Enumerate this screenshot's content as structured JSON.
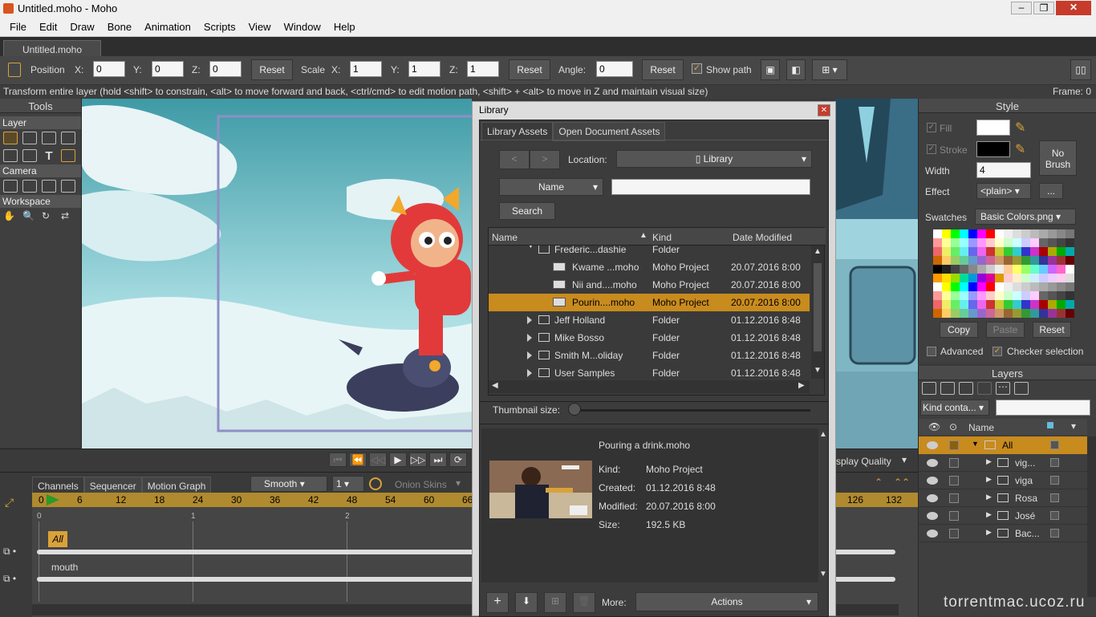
{
  "window": {
    "title": "Untitled.moho - Moho"
  },
  "menu": [
    "File",
    "Edit",
    "Draw",
    "Bone",
    "Animation",
    "Scripts",
    "View",
    "Window",
    "Help"
  ],
  "doc_tab": "Untitled.moho",
  "toolopts": {
    "position": "Position",
    "x_label": "X:",
    "x_val": "0",
    "y_label": "Y:",
    "y_val": "0",
    "z_label": "Z:",
    "z_val": "0",
    "reset": "Reset",
    "scale": "Scale",
    "sx_label": "X:",
    "sx_val": "1",
    "sy_label": "Y:",
    "sy_val": "1",
    "sz_label": "Z:",
    "sz_val": "1",
    "angle": "Angle:",
    "angle_val": "0",
    "show_path": "Show path"
  },
  "hint": "Transform entire layer (hold <shift> to constrain, <alt> to move forward and back, <ctrl/cmd> to edit motion path, <shift> + <alt> to move in Z and maintain visual size)",
  "frame": "Frame: 0",
  "tools": {
    "title": "Tools",
    "layer": "Layer",
    "camera": "Camera",
    "workspace": "Workspace"
  },
  "library": {
    "title": "Library",
    "tabs": [
      "Library Assets",
      "Open Document Assets"
    ],
    "location_label": "Location:",
    "location_value": "Library",
    "sort": "Name",
    "search": "Search",
    "cols": [
      "Name",
      "Kind",
      "Date Modified"
    ],
    "rows": [
      {
        "name": "Frederic...dashie",
        "kind": "Folder",
        "date": "",
        "indent": 1,
        "type": "folder-open"
      },
      {
        "name": "Kwame ...moho",
        "kind": "Moho Project",
        "date": "20.07.2016 8:00",
        "indent": 2,
        "type": "file"
      },
      {
        "name": "Nii and....moho",
        "kind": "Moho Project",
        "date": "20.07.2016 8:00",
        "indent": 2,
        "type": "file"
      },
      {
        "name": "Pourin....moho",
        "kind": "Moho Project",
        "date": "20.07.2016 8:00",
        "indent": 2,
        "type": "file",
        "selected": true
      },
      {
        "name": "Jeff Holland",
        "kind": "Folder",
        "date": "01.12.2016 8:48",
        "indent": 1,
        "type": "folder"
      },
      {
        "name": "Mike Bosso",
        "kind": "Folder",
        "date": "01.12.2016 8:48",
        "indent": 1,
        "type": "folder"
      },
      {
        "name": "Smith M...oliday",
        "kind": "Folder",
        "date": "01.12.2016 8:48",
        "indent": 1,
        "type": "folder"
      },
      {
        "name": "User Samples",
        "kind": "Folder",
        "date": "01.12.2016 8:48",
        "indent": 1,
        "type": "folder"
      }
    ],
    "thumb_label": "Thumbnail size:",
    "detail": {
      "title": "Pouring a drink.moho",
      "kind_l": "Kind:",
      "kind": "Moho Project",
      "created_l": "Created:",
      "created": "01.12.2016 8:48",
      "modified_l": "Modified:",
      "modified": "20.07.2016 8:00",
      "size_l": "Size:",
      "size": "192.5 KB"
    },
    "more": "More:",
    "actions": "Actions"
  },
  "style": {
    "title": "Style",
    "fill": "Fill",
    "stroke": "Stroke",
    "width_l": "Width",
    "width": "4",
    "effect_l": "Effect",
    "effect": "<plain>",
    "nobrush": "No Brush",
    "swatches_l": "Swatches",
    "swatches": "Basic Colors.png",
    "copy": "Copy",
    "paste": "Paste",
    "reset": "Reset",
    "advanced": "Advanced",
    "checker": "Checker selection",
    "dots": "..."
  },
  "layers": {
    "title": "Layers",
    "kind": "Kind conta...",
    "col_name": "Name",
    "items": [
      {
        "name": "All",
        "sel": true,
        "indent": 0
      },
      {
        "name": "vig...",
        "indent": 1
      },
      {
        "name": "viga",
        "indent": 1
      },
      {
        "name": "Rosa",
        "indent": 1
      },
      {
        "name": "José",
        "indent": 1
      },
      {
        "name": "Bac...",
        "indent": 1
      }
    ]
  },
  "timeline": {
    "tabs": [
      "Channels",
      "Sequencer",
      "Motion Graph"
    ],
    "smooth": "Smooth",
    "num": "1",
    "onion": "Onion Skins",
    "quality": "splay Quality",
    "ticks": [
      "0",
      "6",
      "12",
      "18",
      "24",
      "30",
      "36",
      "42",
      "48",
      "54",
      "60",
      "66",
      "126",
      "132"
    ],
    "seq_ticks": [
      "0",
      "1",
      "2"
    ],
    "track_all": "All",
    "track_mouth": "mouth"
  },
  "watermark": "torrentmac.ucoz.ru",
  "colors": {
    "accent": "#c88b1e"
  }
}
